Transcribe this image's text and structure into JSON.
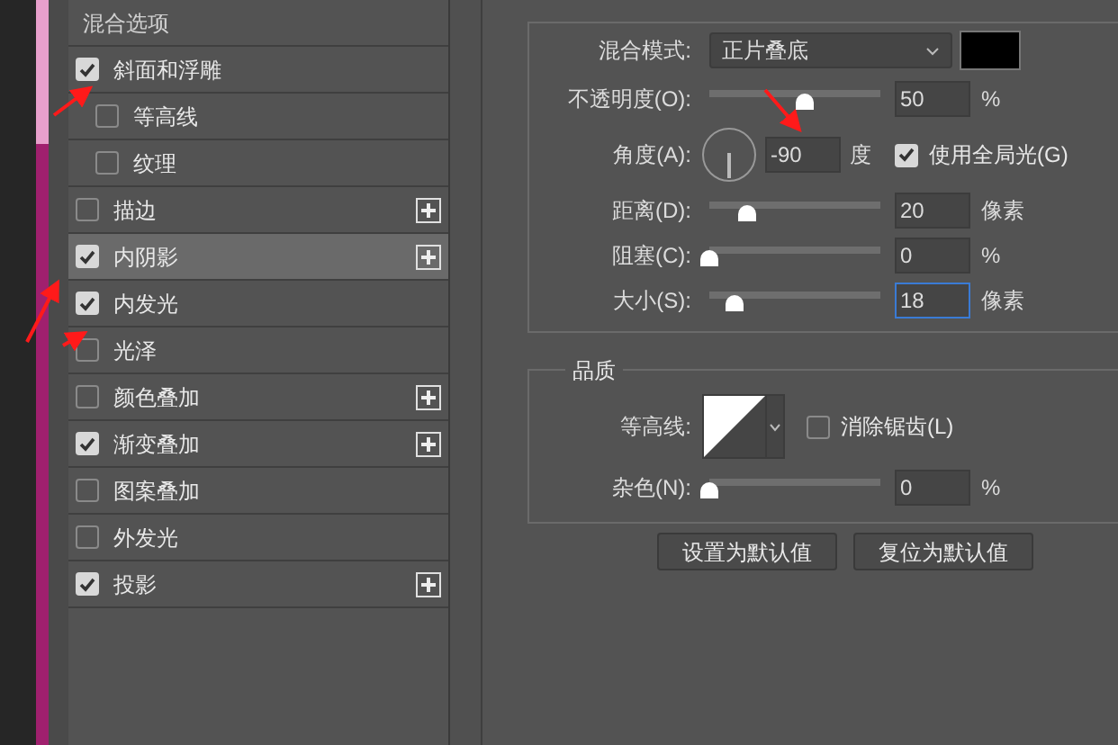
{
  "styles": {
    "header": "混合选项",
    "items": [
      {
        "label": "斜面和浮雕",
        "checked": true,
        "selected": false,
        "add": false,
        "children": [
          {
            "label": "等高线",
            "checked": false,
            "selected": false,
            "add": false
          },
          {
            "label": "纹理",
            "checked": false,
            "selected": false,
            "add": false
          }
        ]
      },
      {
        "label": "描边",
        "checked": false,
        "selected": false,
        "add": true
      },
      {
        "label": "内阴影",
        "checked": true,
        "selected": true,
        "add": true
      },
      {
        "label": "内发光",
        "checked": true,
        "selected": false,
        "add": false
      },
      {
        "label": "光泽",
        "checked": false,
        "selected": false,
        "add": false
      },
      {
        "label": "颜色叠加",
        "checked": false,
        "selected": false,
        "add": true
      },
      {
        "label": "渐变叠加",
        "checked": true,
        "selected": false,
        "add": true
      },
      {
        "label": "图案叠加",
        "checked": false,
        "selected": false,
        "add": false
      },
      {
        "label": "外发光",
        "checked": false,
        "selected": false,
        "add": false
      },
      {
        "label": "投影",
        "checked": true,
        "selected": false,
        "add": true
      }
    ]
  },
  "structure": {
    "blend_mode": {
      "label": "混合模式:",
      "value": "正片叠底"
    },
    "opacity": {
      "label": "不透明度(O):",
      "level": 0.5,
      "value": "50",
      "unit": "%"
    },
    "angle": {
      "label": "角度(A):",
      "value": "-90",
      "unit": "度"
    },
    "global_light": {
      "label": "使用全局光(G)",
      "checked": true
    },
    "sliders": [
      {
        "label": "距离(D):",
        "level": 0.2,
        "value": "20",
        "unit": "像素",
        "focused": false
      },
      {
        "label": "阻塞(C):",
        "level": 0,
        "value": "0",
        "unit": "%",
        "focused": false
      },
      {
        "label": "大小(S):",
        "level": 0.13,
        "value": "18",
        "unit": "像素",
        "focused": true
      }
    ]
  },
  "quality": {
    "title": "品质",
    "contour_label": "等高线:",
    "anti_alias": {
      "label": "消除锯齿(L)",
      "checked": false
    },
    "noise": {
      "label": "杂色(N):",
      "level": 0,
      "value": "0",
      "unit": "%"
    }
  },
  "buttons": [
    "设置为默认值",
    "复位为默认值"
  ]
}
